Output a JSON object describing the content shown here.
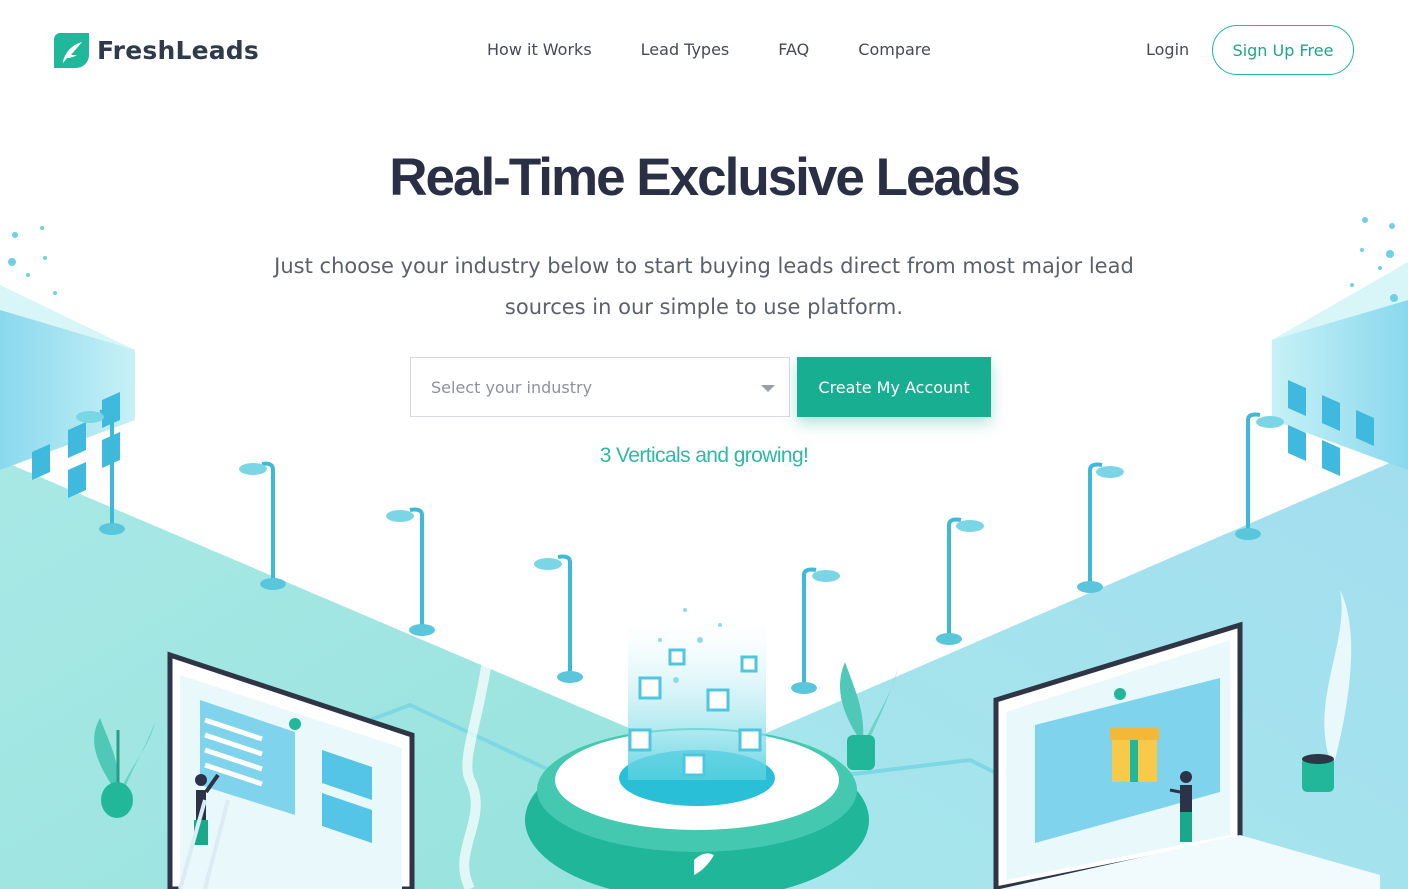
{
  "brand": {
    "name": "FreshLeads",
    "colors": {
      "primary": "#17ae91",
      "accent_text": "#2cb9a5",
      "dark": "#2f3a4a"
    }
  },
  "nav": {
    "items": [
      "How it Works",
      "Lead Types",
      "FAQ",
      "Compare"
    ],
    "login_label": "Login",
    "signup_label": "Sign Up Free"
  },
  "hero": {
    "title": "Real-Time Exclusive Leads",
    "subtitle": "Just choose your industry below to start buying leads direct from most major lead sources in our simple to use platform.",
    "select_placeholder": "Select your industry",
    "cta_label": "Create My Account",
    "tagline": "3 Verticals and growing!"
  },
  "icons": {
    "logo": "leaf-logo-icon",
    "select_caret": "caret-down-icon"
  }
}
